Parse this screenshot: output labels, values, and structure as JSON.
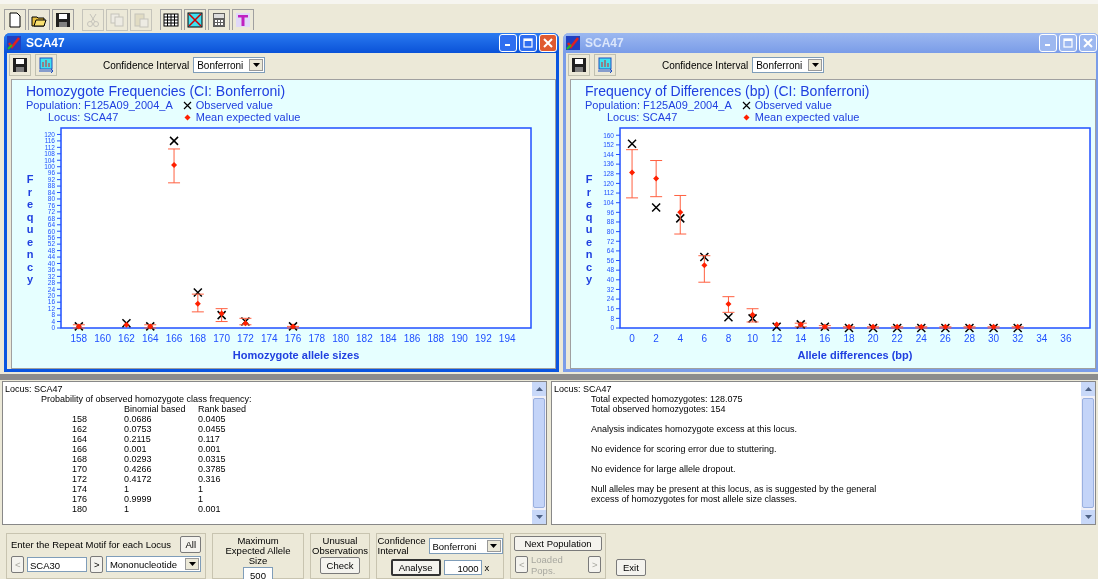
{
  "toolbar": [
    {
      "kind": "new",
      "disabled": false
    },
    {
      "kind": "open",
      "disabled": false
    },
    {
      "kind": "save",
      "disabled": false
    },
    {
      "kind": "cut",
      "disabled": true
    },
    {
      "kind": "copy",
      "disabled": true
    },
    {
      "kind": "paste",
      "disabled": true
    },
    {
      "kind": "grid",
      "disabled": false
    },
    {
      "kind": "chart",
      "disabled": false
    },
    {
      "kind": "calc",
      "disabled": false
    },
    {
      "kind": "type",
      "disabled": false
    }
  ],
  "windows": [
    {
      "title": "SCA47",
      "active": true,
      "ci_label": "Confidence Interval",
      "ci_value": "Bonferroni",
      "population": "Population: F125A09_2004_A",
      "locus": "Locus: SCA47",
      "chart_data": {
        "type": "scatter",
        "title": "Homozygote Frequencies  (CI: Bonferroni)",
        "legend": true,
        "xlabel": "Homozygote allele sizes",
        "ylabel": "Frequency",
        "x": [
          158,
          162,
          164,
          166,
          168,
          170,
          172,
          176
        ],
        "series": [
          {
            "name": "Observed value",
            "color": "#000000",
            "values": [
              1,
              3,
              1,
              116,
              22,
              8,
              4,
              1
            ]
          },
          {
            "name": "Mean expected value",
            "color": "#ff2000",
            "values": [
              1,
              2,
              1,
              101,
              15,
              9,
              3,
              1
            ],
            "errors": [
              [
                0,
                2
              ],
              null,
              [
                0,
                2
              ],
              [
                90,
                111
              ],
              [
                10,
                21
              ],
              [
                4,
                12
              ],
              [
                2,
                6
              ],
              [
                0,
                1
              ]
            ]
          }
        ],
        "xlim": [
          156.5,
          196
        ],
        "ylim": [
          0,
          124
        ],
        "xticks": [
          158,
          160,
          162,
          164,
          166,
          168,
          170,
          172,
          174,
          176,
          178,
          180,
          182,
          184,
          186,
          188,
          190,
          192,
          194
        ],
        "yticks": [
          0,
          4,
          8,
          12,
          16,
          20,
          24,
          28,
          32,
          36,
          40,
          44,
          48,
          52,
          56,
          60,
          64,
          68,
          72,
          76,
          80,
          84,
          88,
          92,
          96,
          100,
          104,
          108,
          112,
          116,
          120
        ]
      }
    },
    {
      "title": "SCA47",
      "active": false,
      "ci_label": "Confidence Interval",
      "ci_value": "Bonferroni",
      "population": "Population: F125A09_2004_A",
      "locus": "Locus: SCA47",
      "chart_data": {
        "type": "scatter",
        "title": "Frequency of Differences (bp)  (CI: Bonferroni)",
        "legend": true,
        "xlabel": "Allele differences (bp)",
        "ylabel": "Frequency",
        "x": [
          0,
          2,
          4,
          6,
          8,
          10,
          12,
          14,
          16,
          18,
          20,
          22,
          24,
          26,
          28,
          30,
          32
        ],
        "series": [
          {
            "name": "Observed value",
            "color": "#000000",
            "values": [
              153,
              100,
              91,
              59,
              9,
              8,
              1,
              3,
              1,
              0,
              0,
              0,
              0,
              0,
              0,
              0,
              0
            ]
          },
          {
            "name": "Mean expected value",
            "color": "#ff2000",
            "values": [
              129,
              124,
              96,
              52,
              20,
              11,
              3,
              3,
              1,
              1,
              1,
              1,
              1,
              1,
              1,
              1,
              1
            ],
            "errors": [
              [
                108,
                148
              ],
              [
                109,
                139
              ],
              [
                78,
                110
              ],
              [
                38,
                60
              ],
              [
                13,
                26
              ],
              [
                5,
                16
              ],
              null,
              [
                1,
                4
              ],
              [
                0,
                2
              ],
              [
                0,
                1
              ],
              [
                0,
                1
              ],
              [
                0,
                1
              ],
              [
                0,
                1
              ],
              [
                0,
                1
              ],
              [
                0,
                1
              ],
              [
                0,
                1
              ],
              [
                0,
                1
              ]
            ]
          }
        ],
        "xlim": [
          -1,
          38
        ],
        "ylim": [
          0,
          166
        ],
        "xticks": [
          0,
          2,
          4,
          6,
          8,
          10,
          12,
          14,
          16,
          18,
          20,
          22,
          24,
          26,
          28,
          30,
          32,
          34,
          36
        ],
        "yticks": [
          0,
          8,
          16,
          24,
          32,
          40,
          48,
          56,
          64,
          72,
          80,
          88,
          96,
          104,
          112,
          120,
          128,
          136,
          144,
          152,
          160
        ]
      }
    }
  ],
  "left_report": {
    "locus": "Locus: SCA47",
    "heading": "Probability of observed homozygote class frequency:",
    "binomial_header": "Binomial based",
    "rank_header": "Rank based",
    "classes": [
      {
        "allele": "158",
        "binomial": "0.0686",
        "rank": "0.0405"
      },
      {
        "allele": "162",
        "binomial": "0.0753",
        "rank": "0.0455"
      },
      {
        "allele": "164",
        "binomial": "0.2115",
        "rank": "0.117"
      },
      {
        "allele": "166",
        "binomial": "0.001",
        "rank": "0.001"
      },
      {
        "allele": "168",
        "binomial": "0.0293",
        "rank": "0.0315"
      },
      {
        "allele": "170",
        "binomial": "0.4266",
        "rank": "0.3785"
      },
      {
        "allele": "172",
        "binomial": "0.4172",
        "rank": "0.316"
      },
      {
        "allele": "174",
        "binomial": "1",
        "rank": "1"
      },
      {
        "allele": "176",
        "binomial": "0.9999",
        "rank": "1"
      },
      {
        "allele": "180",
        "binomial": "1",
        "rank": "0.001"
      }
    ]
  },
  "right_report": {
    "locus": "Locus: SCA47",
    "totals": [
      "Total expected homozygotes: 128.075",
      "Total observed homozygotes: 154"
    ],
    "paragraphs": [
      "Analysis indicates homozygote excess at this locus.",
      "No evidence for scoring error due to stuttering.",
      "No evidence for large allele dropout.",
      "Null alleles may be present at this locus, as is suggested by the general excess of homozygotes for most allele size classes."
    ]
  },
  "controls": {
    "motif_label": "Enter the Repeat Motif for each Locus",
    "all_button": "All",
    "prev": "<",
    "locus_value": "SCA30",
    "next": ">",
    "motif_value": "Mononucleotide",
    "max_label": "Maximum Expected Allele Size",
    "max_value": "500",
    "unusual_label": "Unusual Observations",
    "check_button": "Check",
    "ci_label": "Confidence Interval",
    "ci_value": "Bonferroni",
    "analyse_button": "Analyse",
    "iterations": "1000",
    "times": "x",
    "next_population": "Next Population",
    "pops_prev": "<",
    "loaded_pops": "Loaded Pops.",
    "pops_next": ">",
    "pops_disabled": true,
    "exit_button": "Exit"
  }
}
